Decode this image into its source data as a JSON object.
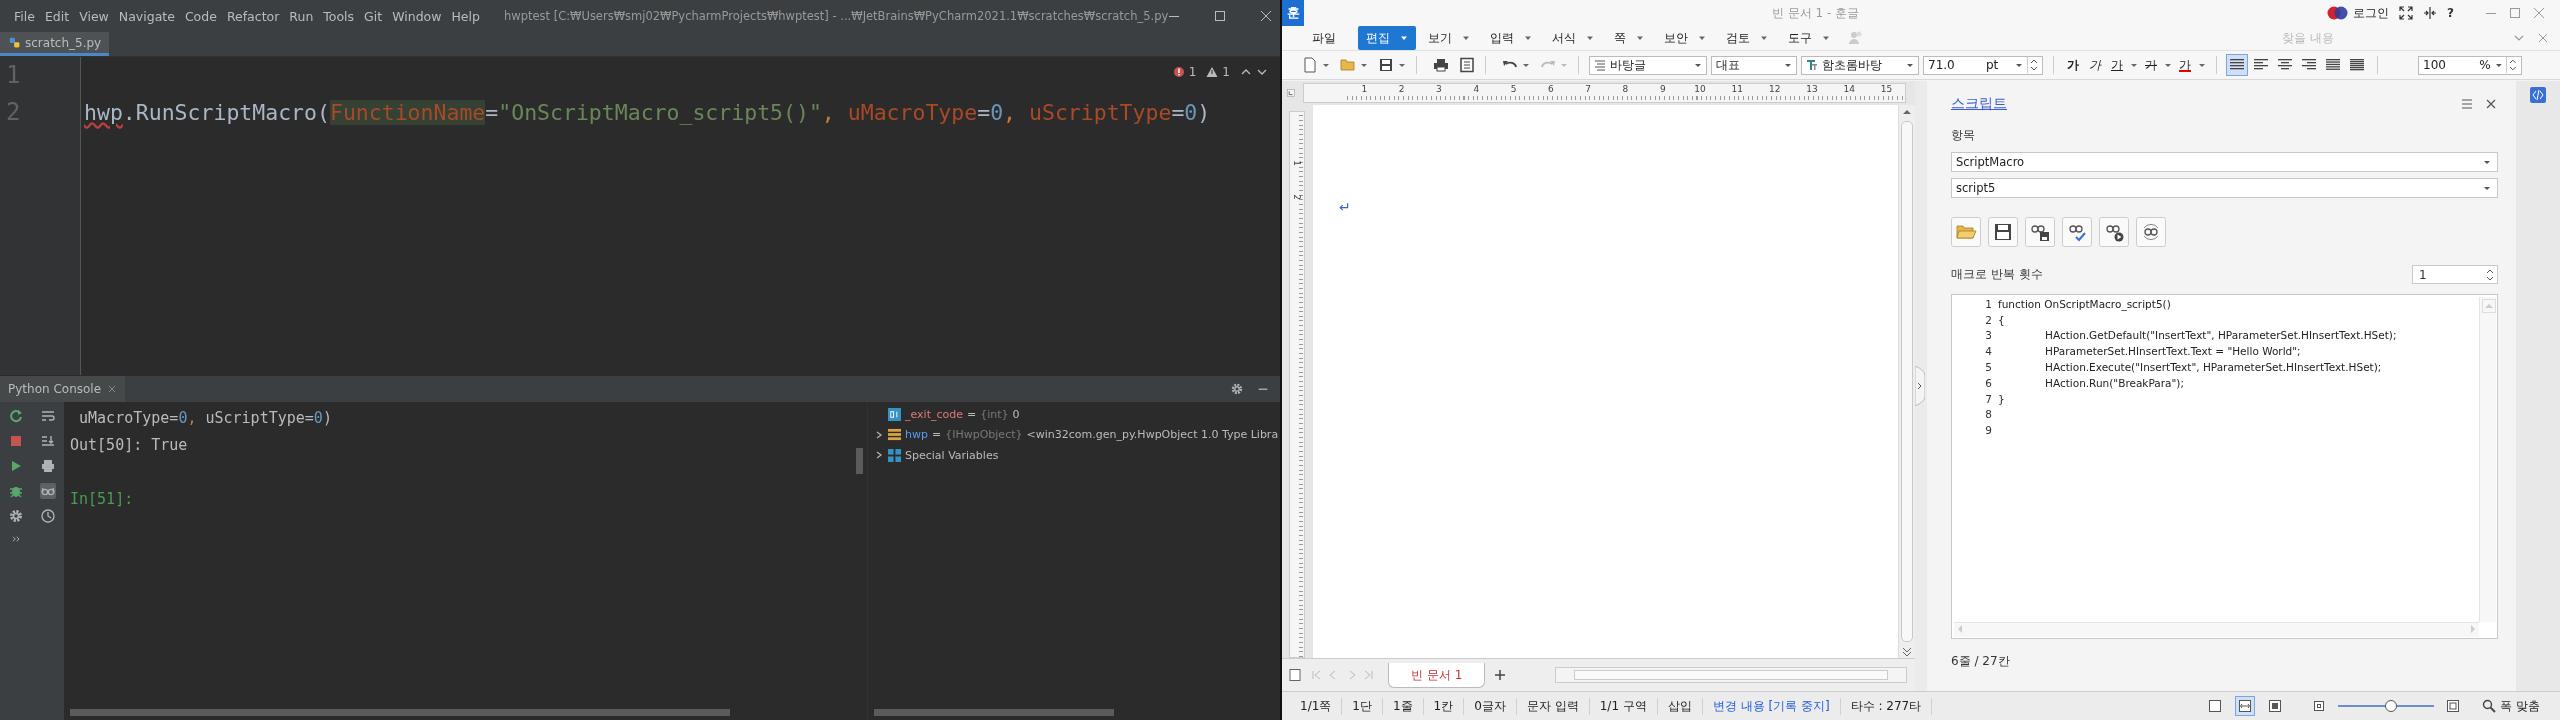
{
  "pycharm": {
    "menus": [
      "File",
      "Edit",
      "View",
      "Navigate",
      "Code",
      "Refactor",
      "Run",
      "Tools",
      "Git",
      "Window",
      "Help"
    ],
    "title": "hwptest [C:₩Users₩smj02₩PycharmProjects₩hwptest] - ...₩JetBrains₩PyCharm2021.1₩scratches₩scratch_5.py",
    "tabs": [
      {
        "label": "scratch_5.py",
        "selected": true
      }
    ],
    "error_count": "1",
    "warning_count": "1",
    "lines": [
      {
        "number": "1"
      },
      {
        "number": "2",
        "tokens": [
          {
            "text": "hwp",
            "kind": "typo"
          },
          {
            "text": ".RunScriptMacro(",
            "kind": "plain"
          },
          {
            "text": "FunctionName",
            "kind": "param_hl"
          },
          {
            "text": "=",
            "kind": "plain"
          },
          {
            "text": "\"OnScriptMacro_script5()\"",
            "kind": "string"
          },
          {
            "text": ", ",
            "kind": "punct"
          },
          {
            "text": "uMacroType",
            "kind": "param"
          },
          {
            "text": "=",
            "kind": "plain"
          },
          {
            "text": "0",
            "kind": "number"
          },
          {
            "text": ", ",
            "kind": "punct"
          },
          {
            "text": "uScriptType",
            "kind": "param"
          },
          {
            "text": "=",
            "kind": "plain"
          },
          {
            "text": "0",
            "kind": "number"
          },
          {
            "text": ")",
            "kind": "plain"
          }
        ]
      }
    ],
    "console": {
      "tab": "Python Console",
      "lines": [
        {
          "kind": "output",
          "tokens": [
            {
              "text": " uMacroType",
              "kind": "white"
            },
            {
              "text": "=",
              "kind": "white"
            },
            {
              "text": "0",
              "kind": "number"
            },
            {
              "text": ", ",
              "kind": "punct"
            },
            {
              "text": "uScriptType",
              "kind": "white"
            },
            {
              "text": "=",
              "kind": "white"
            },
            {
              "text": "0",
              "kind": "number"
            },
            {
              "text": ")",
              "kind": "white"
            }
          ]
        },
        {
          "kind": "output",
          "tokens": [
            {
              "text": "Out[50]: True",
              "kind": "white"
            }
          ]
        },
        {
          "kind": "prompt",
          "tokens": [
            {
              "text": "In[51]:",
              "kind": "prompt"
            }
          ]
        }
      ],
      "variables": [
        {
          "name": "_exit_code",
          "assign": "=",
          "type": "{int}",
          "value": "0",
          "kind": "int",
          "expandable": false
        },
        {
          "name": "hwp",
          "assign": "=",
          "type": "{IHwpObject}",
          "value": "<win32com.gen_py.HwpObject 1.0 Type Libra",
          "kind": "object",
          "expandable": true
        },
        {
          "name": "Special Variables",
          "kind": "group",
          "expandable": true
        }
      ]
    }
  },
  "hwp": {
    "logo": "훈",
    "title": "빈 문서 1 - 훈글",
    "login": "로그인",
    "help": "?",
    "menus": [
      {
        "label": "파일",
        "selected": false,
        "dropdown": false
      },
      {
        "label": "편집",
        "selected": true,
        "dropdown": true
      },
      {
        "label": "보기",
        "selected": false,
        "dropdown": true
      },
      {
        "label": "입력",
        "selected": false,
        "dropdown": true
      },
      {
        "label": "서식",
        "selected": false,
        "dropdown": true
      },
      {
        "label": "쪽",
        "selected": false,
        "dropdown": true
      },
      {
        "label": "보안",
        "selected": false,
        "dropdown": true
      },
      {
        "label": "검토",
        "selected": false,
        "dropdown": true
      },
      {
        "label": "도구",
        "selected": false,
        "dropdown": true
      }
    ],
    "search_placeholder": "찾을 내용",
    "toolbar": {
      "style": "바탕글",
      "language": "대표",
      "font": "함초롬바탕",
      "size": "71.0",
      "unit": "pt",
      "char_buttons": [
        {
          "text": "가",
          "kind": "bold"
        },
        {
          "text": "가",
          "kind": "italic"
        },
        {
          "text": "가",
          "kind": "underline"
        },
        {
          "text": "가",
          "kind": "strike"
        },
        {
          "text": "가",
          "kind": "color"
        }
      ],
      "align_buttons": [
        {
          "kind": "justify",
          "selected": true
        },
        {
          "kind": "left",
          "selected": false
        },
        {
          "kind": "center",
          "selected": false
        },
        {
          "kind": "right",
          "selected": false
        },
        {
          "kind": "distribute",
          "selected": false
        },
        {
          "kind": "divide",
          "selected": false
        }
      ],
      "zoom": "100",
      "zoom_unit": "%"
    },
    "ruler": [
      "1",
      "2",
      "3",
      "4",
      "5",
      "6",
      "7",
      "8",
      "9",
      "10",
      "11",
      "12",
      "13",
      "14",
      "15"
    ],
    "vertical_ruler": [
      "1",
      "2"
    ],
    "paragraph_mark": "↵",
    "doc_tabs": [
      {
        "label": "빈 문서 1",
        "selected": true
      }
    ],
    "panel": {
      "title": "스크립트",
      "item_label": "항목",
      "item_value": "ScriptMacro",
      "script_value": "script5",
      "repeat_label": "매크로 반복 횟수",
      "repeat_value": "1",
      "code": [
        {
          "number": "1",
          "text": "function OnScriptMacro_script5()"
        },
        {
          "number": "2",
          "text": "{"
        },
        {
          "number": "3",
          "text": "\tHAction.GetDefault(\"InsertText\", HParameterSet.HInsertText.HSet);"
        },
        {
          "number": "4",
          "text": "\tHParameterSet.HInsertText.Text = \"Hello World\";"
        },
        {
          "number": "5",
          "text": "\tHAction.Execute(\"InsertText\", HParameterSet.HInsertText.HSet);"
        },
        {
          "number": "6",
          "text": "\tHAction.Run(\"BreakPara\");"
        },
        {
          "number": "7",
          "text": "}"
        },
        {
          "number": "8"
        },
        {
          "number": "9"
        }
      ],
      "status": "6줄 / 27칸"
    },
    "status_bar": [
      {
        "text": "1/1쪽",
        "kind": "plain"
      },
      {
        "text": "1단",
        "kind": "plain"
      },
      {
        "text": "1줄",
        "kind": "plain"
      },
      {
        "text": "1칸",
        "kind": "plain"
      },
      {
        "text": "0글자",
        "kind": "plain"
      },
      {
        "text": "문자 입력",
        "kind": "plain"
      },
      {
        "text": "1/1 구역",
        "kind": "plain"
      },
      {
        "text": "삽입",
        "kind": "plain"
      },
      {
        "text": "변경 내용 [기록 중지]",
        "kind": "link"
      },
      {
        "text": "타수 : 277타",
        "kind": "plain"
      }
    ],
    "view_modes": [
      {
        "kind": "page",
        "selected": false
      },
      {
        "kind": "width",
        "selected": true
      },
      {
        "kind": "full",
        "selected": false
      }
    ],
    "zoom_slider": {
      "level": 0.55
    },
    "zoom_fit": "폭 맞춤"
  }
}
